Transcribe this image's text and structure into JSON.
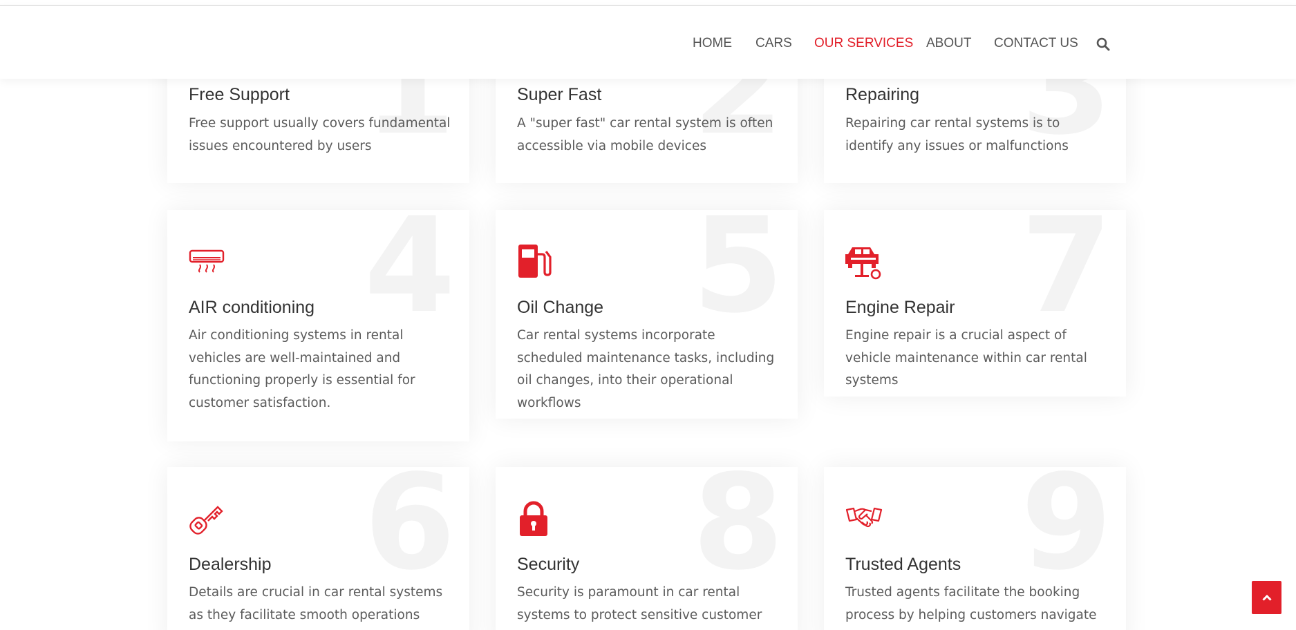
{
  "nav": {
    "home": "HOME",
    "cars": "CARS",
    "services": "OUR SERVICES",
    "about": "ABOUT",
    "contact": "CONTACT US"
  },
  "colors": {
    "accent": "#e2202a",
    "number": "#f3f3f3"
  },
  "services": [
    {
      "number": "1",
      "title": "Free Support",
      "description": "Free support usually covers fundamental issues encountered by users",
      "icon": "support-icon"
    },
    {
      "number": "2",
      "title": "Super Fast",
      "description": "A \"super fast\" car rental system is often accessible via mobile devices",
      "icon": "speed-icon"
    },
    {
      "number": "3",
      "title": "Repairing",
      "description": "Repairing car rental systems is to identify any issues or malfunctions",
      "icon": "repair-icon"
    },
    {
      "number": "4",
      "title": "AIR conditioning",
      "description": "Air conditioning systems in rental vehicles are well-maintained and functioning properly is essential for customer satisfaction.",
      "icon": "air-conditioner-icon"
    },
    {
      "number": "5",
      "title": "Oil Change",
      "description": "Car rental systems incorporate scheduled maintenance tasks, including oil changes, into their operational workflows",
      "icon": "fuel-pump-icon"
    },
    {
      "number": "7",
      "title": "Engine Repair",
      "description": "Engine repair is a crucial aspect of vehicle maintenance within car rental systems",
      "icon": "car-lift-icon"
    },
    {
      "number": "6",
      "title": "Dealership",
      "description": "Details are crucial in car rental systems as they facilitate smooth operations",
      "icon": "car-key-icon"
    },
    {
      "number": "8",
      "title": "Security",
      "description": "Security is paramount in car rental systems to protect sensitive customer data",
      "icon": "padlock-icon"
    },
    {
      "number": "9",
      "title": "Trusted Agents",
      "description": "Trusted agents facilitate the booking process by helping customers navigate",
      "icon": "handshake-icon"
    }
  ]
}
